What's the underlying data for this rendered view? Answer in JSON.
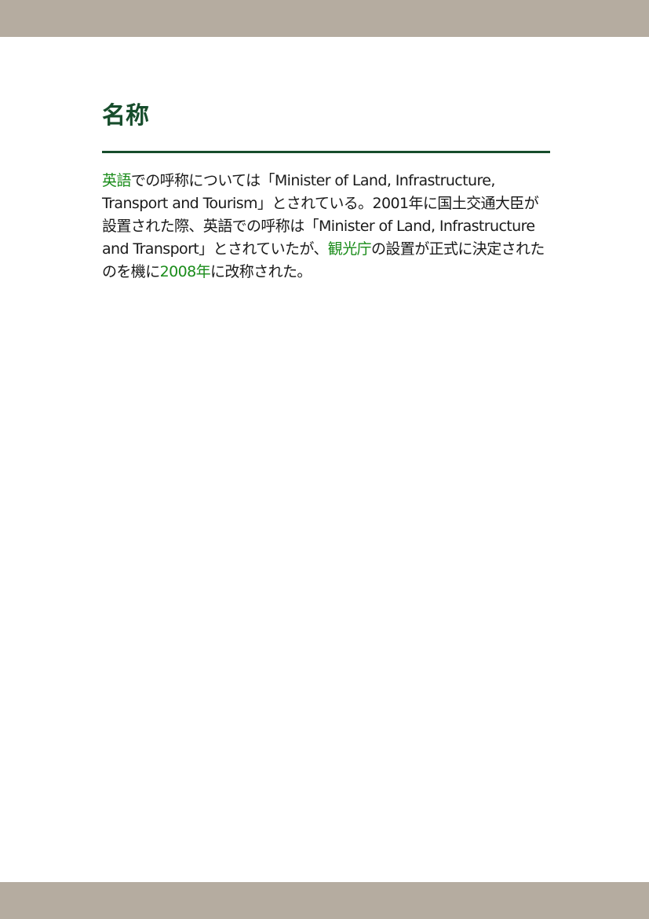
{
  "section": {
    "title": "名称"
  },
  "paragraph": {
    "link_english": "英語",
    "text_1": "での呼称については「Minister of Land, Infrastructure, Transport and Tourism」とされている。2001年に国土交通大臣が設置された際、英語での呼称は「Minister of Land, Infrastructure and Transport」とされていたが、",
    "link_kankocho": "観光庁",
    "text_2": "の設置が正式に決定されたのを機に",
    "link_2008": "2008年",
    "text_3": "に改称された。"
  },
  "colors": {
    "header_bar": "#b5aca0",
    "heading": "#174d2c",
    "link": "#1a8c1a",
    "body_text": "#1a1a1a"
  }
}
